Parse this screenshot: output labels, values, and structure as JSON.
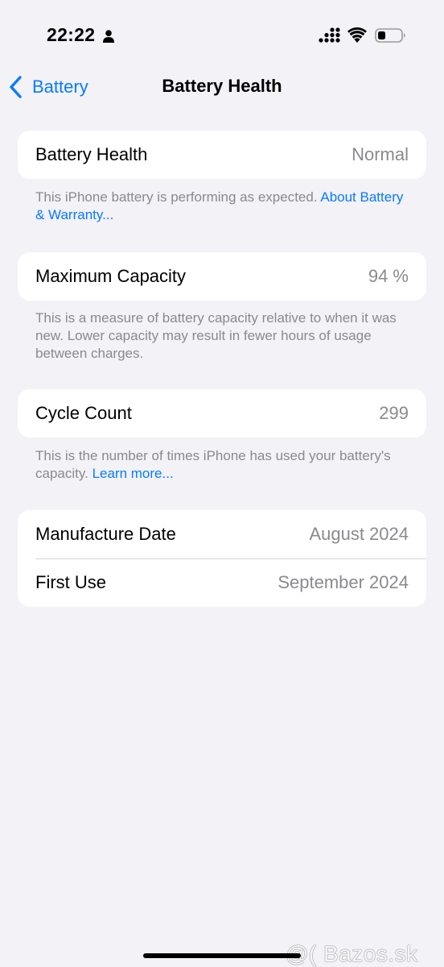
{
  "status_bar": {
    "time": "22:22",
    "icons": [
      "person-icon",
      "cellular-signal-icon",
      "wifi-icon",
      "battery-icon"
    ]
  },
  "nav": {
    "back_label": "Battery",
    "title": "Battery Health"
  },
  "battery_health": {
    "label": "Battery Health",
    "value": "Normal",
    "footnote_text": "This iPhone battery is performing as expected. ",
    "footnote_link": "About Battery & Warranty..."
  },
  "maximum_capacity": {
    "label": "Maximum Capacity",
    "value": "94 %",
    "footnote_text": "This is a measure of battery capacity relative to when it was new. Lower capacity may result in fewer hours of usage between charges."
  },
  "cycle_count": {
    "label": "Cycle Count",
    "value": "299",
    "footnote_text": "This is the number of times iPhone has used your battery's capacity. ",
    "footnote_link": "Learn more..."
  },
  "dates": {
    "manufacture_label": "Manufacture Date",
    "manufacture_value": "August 2024",
    "first_use_label": "First Use",
    "first_use_value": "September 2024"
  },
  "watermark": "@( Bazos.sk",
  "colors": {
    "accent": "#0a7aff",
    "background": "#f2f2f7",
    "secondary_text": "#8a8a8e"
  }
}
